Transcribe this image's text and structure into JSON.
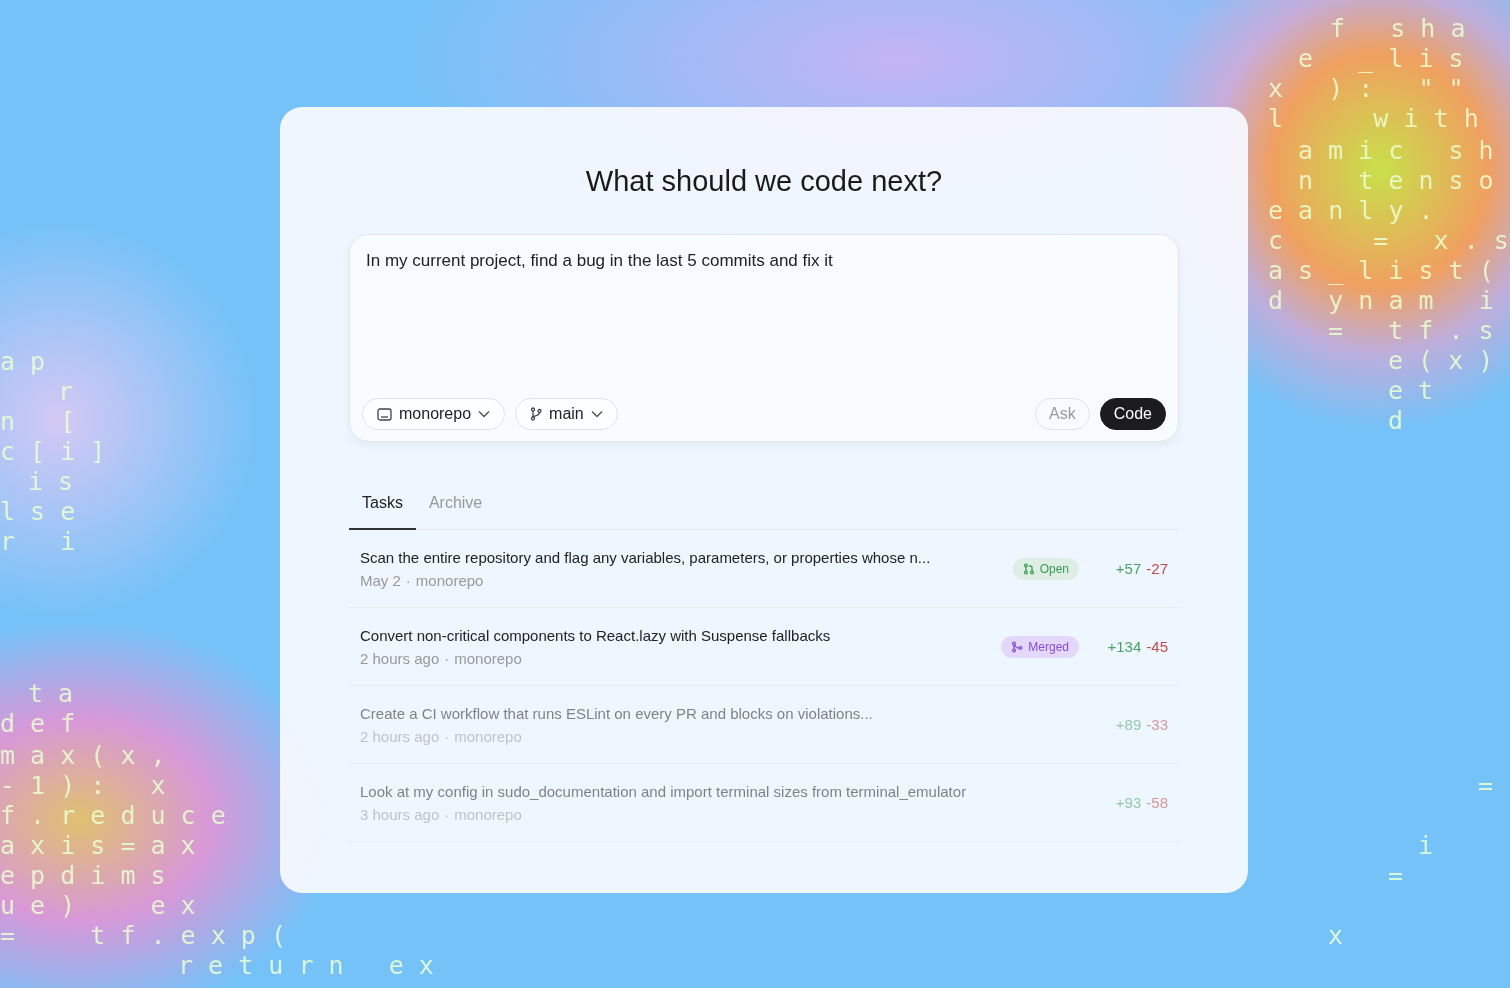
{
  "background_code": [
    "f   s h a",
    "e   _ l i s",
    "x   ) :   \" \"",
    "l      w i t h",
    "a m i c   s h",
    "n   t e n s o",
    "e a n l y .",
    "c      =   x . s",
    "a s _ l i s t (",
    "d   y n a m   i",
    "=   t f . s",
    "e ( x )",
    "e t",
    "d",
    "=",
    "i",
    "=",
    "x",
    "a p",
    "r",
    "n   [",
    "c [ i ]",
    "i s",
    "l s e",
    "r   i",
    "t a",
    "d e f",
    "m a x ( x ,",
    "- 1 ) :   x",
    "f . r e d u c e",
    "a x i s = a x",
    "e p d i m s",
    "u e )     e x",
    "=     t f . e x p (",
    "r e t u r n   e x"
  ],
  "title": "What should we code next?",
  "prompt": {
    "value": "In my current project, find a bug in the last 5 commits and fix it",
    "repo": "monorepo",
    "branch": "main",
    "buttons": [
      {
        "label": "Ask",
        "kind": "secondary"
      },
      {
        "label": "Code",
        "kind": "primary"
      }
    ]
  },
  "tabs": [
    {
      "label": "Tasks",
      "selected": true
    },
    {
      "label": "Archive",
      "selected": false
    }
  ],
  "tasks": [
    {
      "title": "Scan the entire repository and flag any variables, parameters, or properties whose n...",
      "time": "May 2",
      "separator": "·",
      "repo": "monorepo",
      "badge": {
        "kind": "open",
        "label": "Open"
      },
      "additions": "+57",
      "deletions": "-27",
      "faded": false
    },
    {
      "title": "Convert non-critical components to React.lazy with Suspense fallbacks",
      "time": "2 hours ago",
      "separator": "·",
      "repo": "monorepo",
      "badge": {
        "kind": "merged",
        "label": "Merged"
      },
      "additions": "+134",
      "deletions": "-45",
      "faded": false
    },
    {
      "title": "Create a CI workflow that runs ESLint on every PR and blocks on violations...",
      "time": "2 hours ago",
      "separator": "·",
      "repo": "monorepo",
      "additions": "+89",
      "deletions": "-33",
      "faded": true
    },
    {
      "title": "Look at my config in sudo_documentation and import terminal sizes from terminal_emulator",
      "time": "3 hours ago",
      "separator": "·",
      "repo": "monorepo",
      "additions": "+93",
      "deletions": "-58",
      "faded": true
    }
  ]
}
